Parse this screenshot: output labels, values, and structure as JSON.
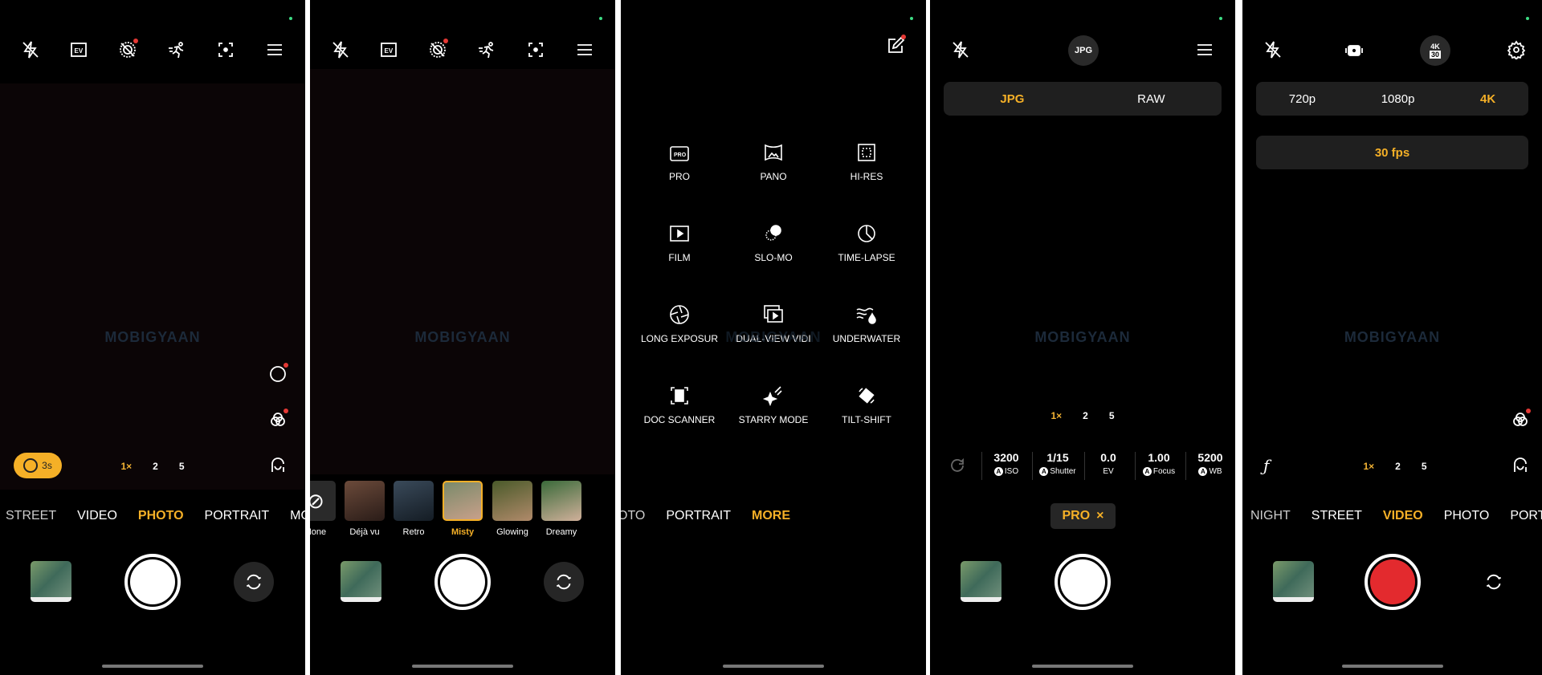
{
  "colors": {
    "accent": "#f5b027",
    "record": "#e32a2e",
    "notification": "#e53935"
  },
  "watermark": "MOBIGYAAN",
  "panel1": {
    "timer": "3s",
    "zoom": [
      "1×",
      "2",
      "5"
    ],
    "modes": [
      "STREET",
      "VIDEO",
      "PHOTO",
      "PORTRAIT",
      "MORE"
    ],
    "active_mode": "PHOTO"
  },
  "panel2": {
    "filters": [
      "None",
      "Déjà vu",
      "Retro",
      "Misty",
      "Glowing",
      "Dreamy"
    ],
    "active_filter": "Misty"
  },
  "panel3": {
    "modes_grid": [
      "PRO",
      "PANO",
      "HI-RES",
      "FILM",
      "SLO-MO",
      "TIME-LAPSE",
      "LONG EXPOSUR",
      "DUAL-VIEW VIDI",
      "UNDERWATER",
      "DOC SCANNER",
      "STARRY MODE",
      "TILT-SHIFT"
    ],
    "mode_row": [
      "OTO",
      "PORTRAIT",
      "MORE"
    ],
    "active_mode": "MORE"
  },
  "panel4": {
    "format_badge": "JPG",
    "formats": [
      "JPG",
      "RAW"
    ],
    "active_format": "JPG",
    "zoom": [
      "1×",
      "2",
      "5"
    ],
    "params": [
      {
        "value": "3200",
        "label": "ISO",
        "auto": true
      },
      {
        "value": "1/15",
        "label": "Shutter",
        "auto": true
      },
      {
        "value": "0.0",
        "label": "EV",
        "auto": false
      },
      {
        "value": "1.00",
        "label": "Focus",
        "auto": true
      },
      {
        "value": "5200",
        "label": "WB",
        "auto": true
      }
    ],
    "auto_badge": "A",
    "pro_chip": "PRO",
    "pro_close": "×"
  },
  "panel5": {
    "badge_top": "4K",
    "badge_bottom": "30",
    "resolutions": [
      "720p",
      "1080p",
      "4K"
    ],
    "active_resolution": "4K",
    "fps": "30 fps",
    "zoom": [
      "1×",
      "2",
      "5"
    ],
    "modes": [
      "NIGHT",
      "STREET",
      "VIDEO",
      "PHOTO",
      "PORTRA"
    ],
    "active_mode": "VIDEO",
    "log_icon": "ƒ"
  }
}
